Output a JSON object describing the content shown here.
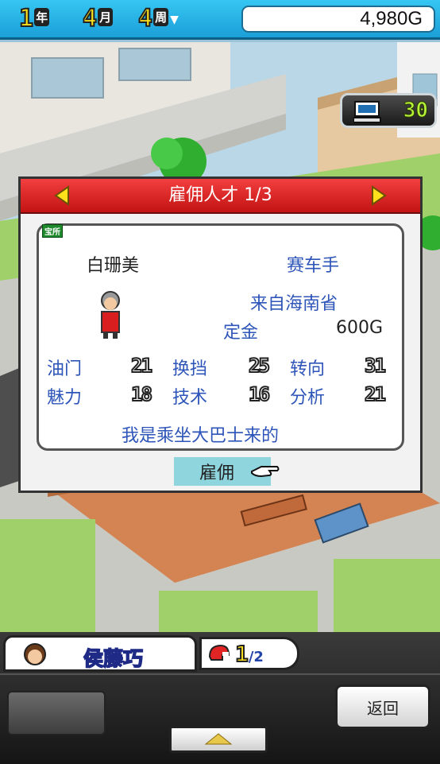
{
  "top_bar": {
    "year_num": "1",
    "year_label": "年",
    "month_num": "4",
    "month_label": "月",
    "week_num": "4",
    "week_label": "周",
    "money": "4,980G"
  },
  "pc_badge": {
    "value": "30"
  },
  "dialog": {
    "title": "雇佣人才 1/3",
    "role_tag": "宝所",
    "candidate": {
      "name": "白珊美",
      "job": "赛车手",
      "origin": "来自海南省",
      "deposit_label": "定金",
      "deposit": "600G",
      "stats": [
        {
          "label": "油门",
          "value": "21"
        },
        {
          "label": "换挡",
          "value": "25"
        },
        {
          "label": "转向",
          "value": "31"
        },
        {
          "label": "魅力",
          "value": "18"
        },
        {
          "label": "技术",
          "value": "16"
        },
        {
          "label": "分析",
          "value": "21"
        }
      ],
      "quote": "我是乘坐大巴士来的"
    },
    "hire_label": "雇佣"
  },
  "bottom": {
    "staff_name": "侯藤巧",
    "count_big": "1",
    "count_small": "/2",
    "back_label": "返回"
  },
  "colors": {
    "topbar": "#1fa8df",
    "header_red": "#d92020",
    "label_blue": "#2d54b8",
    "hire_button": "#8fd5de"
  }
}
